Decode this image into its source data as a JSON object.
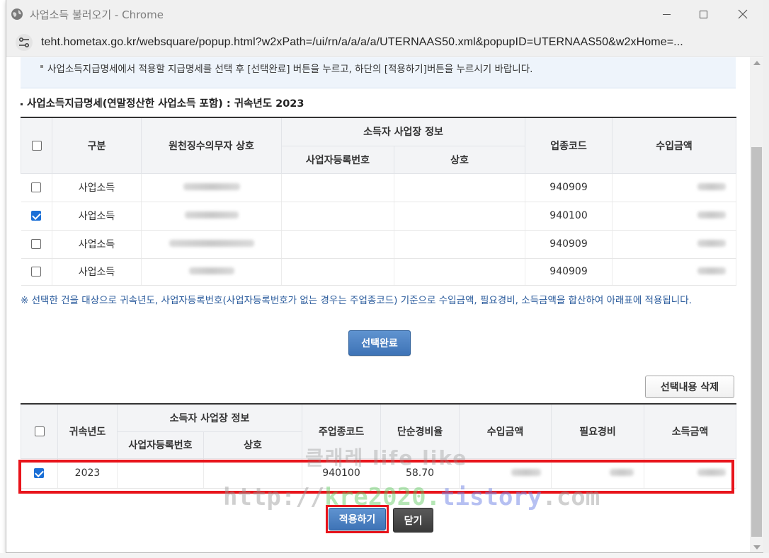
{
  "window": {
    "title": "사업소득 불러오기 - Chrome",
    "url": "teht.hometax.go.kr/websquare/popup.html?w2xPath=/ui/rn/a/a/a/a/UTERNAAS50.xml&popupID=UTERNAAS50&w2xHome=..."
  },
  "notice": "사업소득지급명세에서 적용할 지급명세를 선택 후 [선택완료] 버튼을 누르고, 하단의 [적용하기]버튼을 누르시기 바랍니다.",
  "section_title": "사업소득지급명세(연말정산한 사업소득 포함) : 귀속년도 2023",
  "table1": {
    "headers": {
      "category": "구분",
      "withholder": "원천징수의무자 상호",
      "group": "소득자 사업장 정보",
      "biz_reg_no": "사업자등록번호",
      "trade_name": "상호",
      "industry_code": "업종코드",
      "revenue": "수입금액"
    },
    "rows": [
      {
        "checked": false,
        "category": "사업소득",
        "industry_code": "940909"
      },
      {
        "checked": true,
        "category": "사업소득",
        "industry_code": "940100"
      },
      {
        "checked": false,
        "category": "사업소득",
        "industry_code": "940909"
      },
      {
        "checked": false,
        "category": "사업소득",
        "industry_code": "940909"
      }
    ]
  },
  "note": "※ 선택한 건을 대상으로 귀속년도, 사업자등록번호(사업자등록번호가 없는 경우는 주업종코드) 기준으로 수입금액, 필요경비, 소득금액을 합산하여 아래표에 적용됩니다.",
  "buttons": {
    "select_done": "선택완료",
    "delete_selected": "선택내용 삭제",
    "apply": "적용하기",
    "close": "닫기"
  },
  "table2": {
    "headers": {
      "year": "귀속년도",
      "group": "소득자 사업장 정보",
      "biz_reg_no": "사업자등록번호",
      "trade_name": "상호",
      "main_industry_code": "주업종코드",
      "simple_expense_rate": "단순경비율",
      "revenue": "수입금액",
      "expenses": "필요경비",
      "income": "소득금액"
    },
    "rows": [
      {
        "checked": true,
        "year": "2023",
        "main_industry_code": "940100",
        "simple_expense_rate": "58.70"
      }
    ]
  },
  "watermark": {
    "line1": "클래레 life like",
    "line2a": "http://",
    "line2b": "kre2020.",
    "line2c": "tistory",
    "line2d": ".com"
  },
  "colors": {
    "accent_blue": "#3e73b6",
    "highlight_red": "#e8141b",
    "checkbox_blue": "#1a6fd6"
  }
}
